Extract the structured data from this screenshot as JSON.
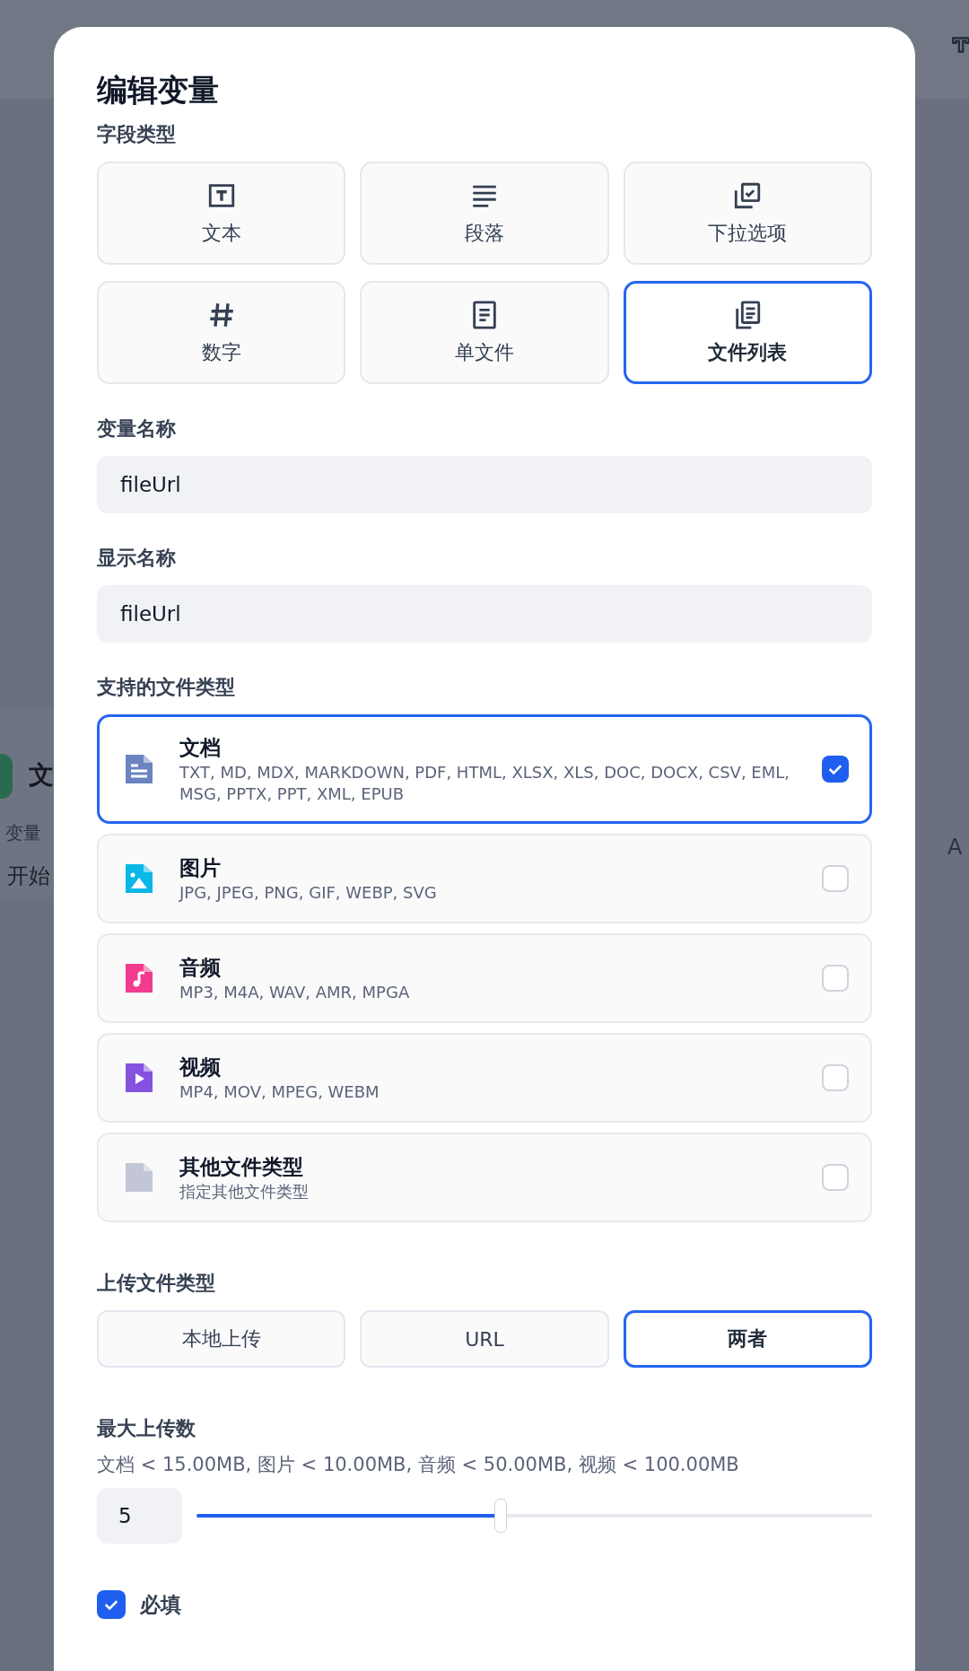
{
  "background": {
    "node_title": "文",
    "node_subtitle": "变量",
    "node_row": "开始",
    "right_text": "A"
  },
  "dialog": {
    "title": "编辑变量",
    "field_type": {
      "label": "字段类型",
      "options": [
        {
          "kind": "text",
          "label": "文本",
          "selected": false
        },
        {
          "kind": "paragraph",
          "label": "段落",
          "selected": false
        },
        {
          "kind": "select",
          "label": "下拉选项",
          "selected": false
        },
        {
          "kind": "number",
          "label": "数字",
          "selected": false
        },
        {
          "kind": "file",
          "label": "单文件",
          "selected": false
        },
        {
          "kind": "file-list",
          "label": "文件列表",
          "selected": true
        }
      ]
    },
    "variable_name": {
      "label": "变量名称",
      "value": "fileUrl"
    },
    "display_name": {
      "label": "显示名称",
      "value": "fileUrl"
    },
    "file_types": {
      "label": "支持的文件类型",
      "items": [
        {
          "kind": "document",
          "name": "文档",
          "extensions": "TXT, MD, MDX, MARKDOWN, PDF, HTML, XLSX, XLS, DOC, DOCX, CSV, EML, MSG, PPTX, PPT, XML, EPUB",
          "checked": true,
          "color": "#6b84c0"
        },
        {
          "kind": "image",
          "name": "图片",
          "extensions": "JPG, JPEG, PNG, GIF, WEBP, SVG",
          "checked": false,
          "color": "#0bb7e6"
        },
        {
          "kind": "audio",
          "name": "音频",
          "extensions": "MP3, M4A, WAV, AMR, MPGA",
          "checked": false,
          "color": "#f23b8e"
        },
        {
          "kind": "video",
          "name": "视频",
          "extensions": "MP4, MOV, MPEG, WEBM",
          "checked": false,
          "color": "#8552e0"
        },
        {
          "kind": "other",
          "name": "其他文件类型",
          "extensions": "指定其他文件类型",
          "checked": false,
          "color": "#c2c6d6"
        }
      ]
    },
    "upload_method": {
      "label": "上传文件类型",
      "options": [
        {
          "label": "本地上传",
          "selected": false
        },
        {
          "label": "URL",
          "selected": false
        },
        {
          "label": "两者",
          "selected": true
        }
      ]
    },
    "max_uploads": {
      "label": "最大上传数",
      "hint": "文档 < 15.00MB, 图片 < 10.00MB, 音频 < 50.00MB, 视频 < 100.00MB",
      "value": "5",
      "level": 0.45
    },
    "required": {
      "label": "必填",
      "checked": true
    }
  }
}
